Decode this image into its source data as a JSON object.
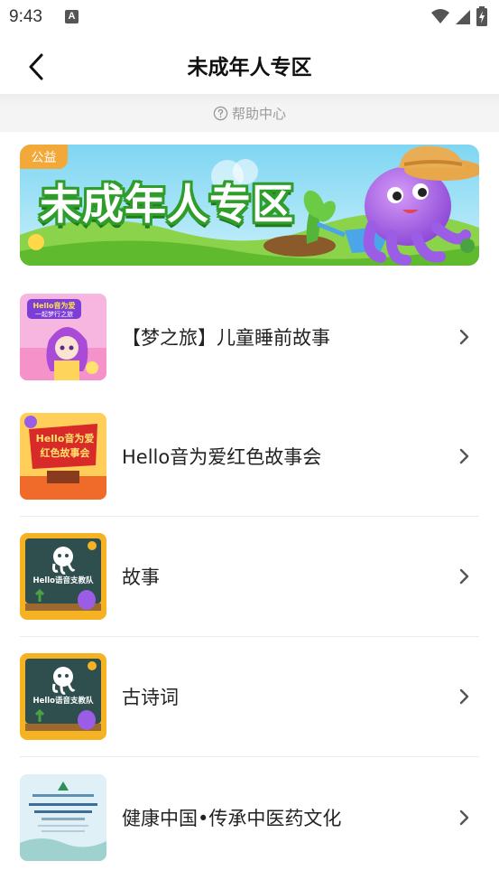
{
  "status_bar": {
    "time": "9:43",
    "notification_letter": "A"
  },
  "nav": {
    "title": "未成年人专区"
  },
  "help": {
    "label": "帮助中心"
  },
  "banner": {
    "tag": "公益",
    "title": "未成年人专区"
  },
  "items": [
    {
      "label": "【梦之旅】儿童睡前故事",
      "thumb_text": "Hello音为爱\n一起梦行之旅"
    },
    {
      "label": "Hello音为爱红色故事会",
      "thumb_text": "Hello音为爱\n红色故事会"
    },
    {
      "label": "故事",
      "thumb_text": "Hello语音支教队"
    },
    {
      "label": "古诗词",
      "thumb_text": "Hello语音支教队"
    },
    {
      "label": "健康中国•传承中医药文化",
      "thumb_text": ""
    }
  ],
  "colors": {
    "accent": "#f2a93a",
    "banner_green": "#2f9d2a",
    "octopus_purple": "#9b5de5"
  }
}
